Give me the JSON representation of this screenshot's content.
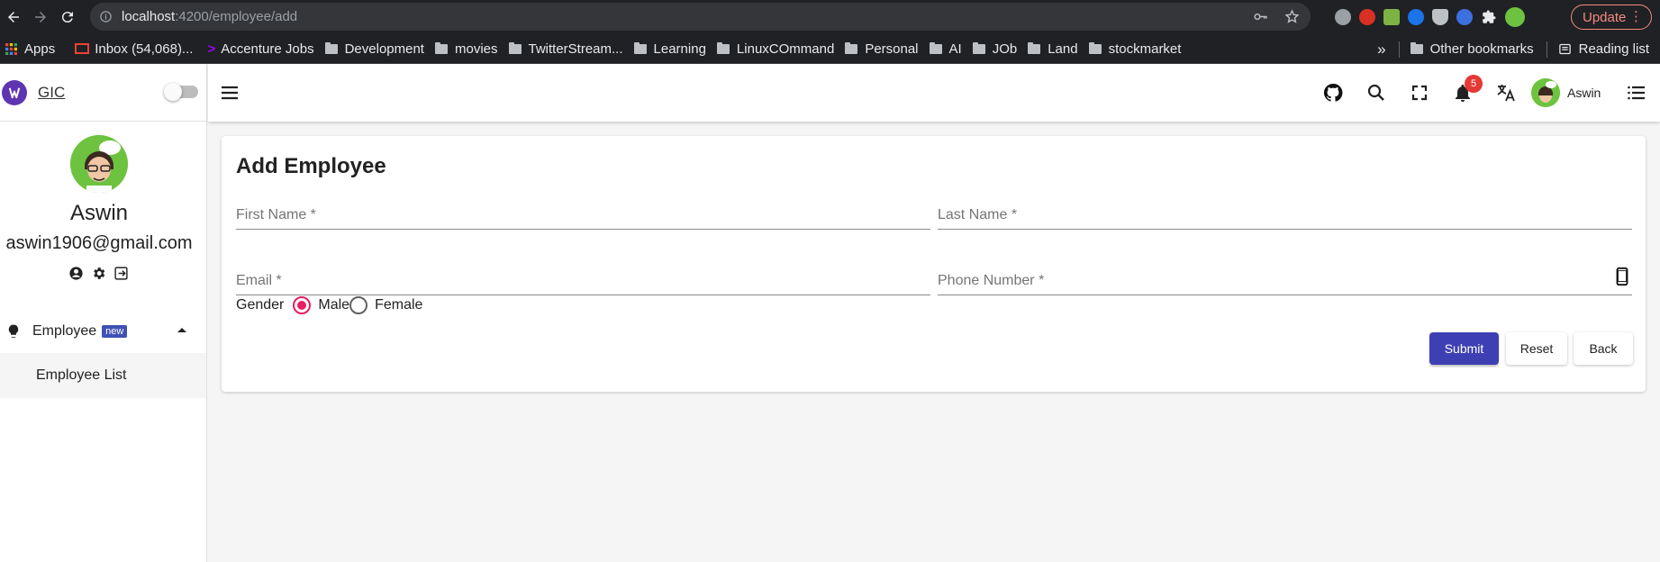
{
  "browser": {
    "url_host": "localhost",
    "url_path": ":4200/employee/add",
    "update_label": "Update",
    "update_menu": "⋮"
  },
  "bookmarks": {
    "apps": "Apps",
    "items": [
      "Inbox (54,068)...",
      "Accenture Jobs",
      "Development",
      "movies",
      "TwitterStream...",
      "Learning",
      "LinuxCOmmand",
      "Personal",
      "AI",
      "JOb",
      "Land",
      "stockmarket"
    ],
    "overflow": "»",
    "other": "Other bookmarks",
    "reading_list": "Reading list"
  },
  "sidebar": {
    "brand": "GIC",
    "user": {
      "name": "Aswin",
      "email": "aswin1906@gmail.com"
    },
    "nav": {
      "employee_label": "Employee",
      "employee_badge": "new",
      "employee_list_label": "Employee List"
    }
  },
  "topbar": {
    "notification_count": "5",
    "username": "Aswin"
  },
  "form": {
    "title": "Add Employee",
    "first_name_placeholder": "First Name *",
    "last_name_placeholder": "Last Name *",
    "email_placeholder": "Email *",
    "phone_placeholder": "Phone Number *",
    "gender_label": "Gender",
    "gender_options": [
      "Male",
      "Female"
    ],
    "gender_selected": "Male",
    "submit_label": "Submit",
    "reset_label": "Reset",
    "back_label": "Back"
  },
  "colors": {
    "primary": "#3f3fb4",
    "accent": "#e91e63",
    "badge": "#3f51b5",
    "notification": "#e53935"
  }
}
